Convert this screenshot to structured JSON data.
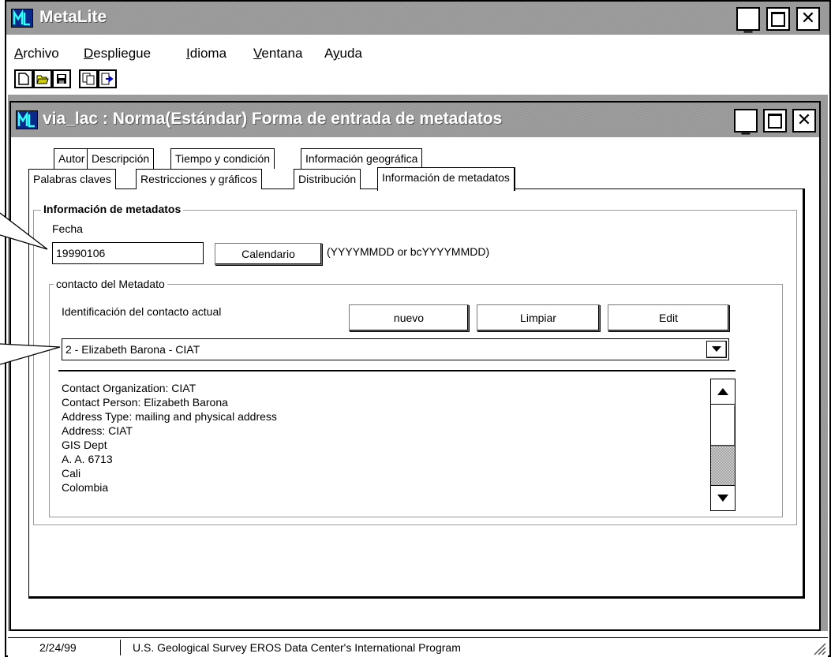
{
  "app": {
    "title": "MetaLite",
    "menu": [
      "Archivo",
      "Despliegue",
      "Idioma",
      "Ventana",
      "Ayuda"
    ],
    "menu_mnemonics": [
      "A",
      "D",
      "I",
      "V",
      "y"
    ]
  },
  "child_window": {
    "title": "via_lac : Norma(Estándar) Forma de entrada de metadatos"
  },
  "tabs": {
    "row1": [
      "Autor",
      "Descripción",
      "Tiempo y condición",
      "Información geográfica"
    ],
    "row2": [
      "Palabras claves",
      "Restricciones y gráficos",
      "Distribución",
      "Información de metadatos"
    ],
    "active": "Información de metadatos"
  },
  "form": {
    "section_title": "Información de metadatos",
    "date_label": "Fecha",
    "date_value": "19990106",
    "calendar_button": "Calendario",
    "date_format_hint": "(YYYYMMDD or bcYYYYMMDD)",
    "contact_group_title": "contacto del Metadato",
    "contact_id_label": "Identificación del contacto actual",
    "btn_new": "nuevo",
    "btn_clear": "Limpiar",
    "btn_edit": "Edit",
    "contact_selected": "2 - Elizabeth Barona - CIAT",
    "contact_details": [
      "Contact Organization:  CIAT",
      "Contact Person:  Elizabeth Barona",
      "Address Type:  mailing and physical address",
      "Address:  CIAT",
      "GIS Dept",
      "A. A. 6713",
      "Cali",
      "Colombia"
    ]
  },
  "status": {
    "date": "2/24/99",
    "message": "U.S. Geological Survey EROS Data Center's International Program"
  }
}
